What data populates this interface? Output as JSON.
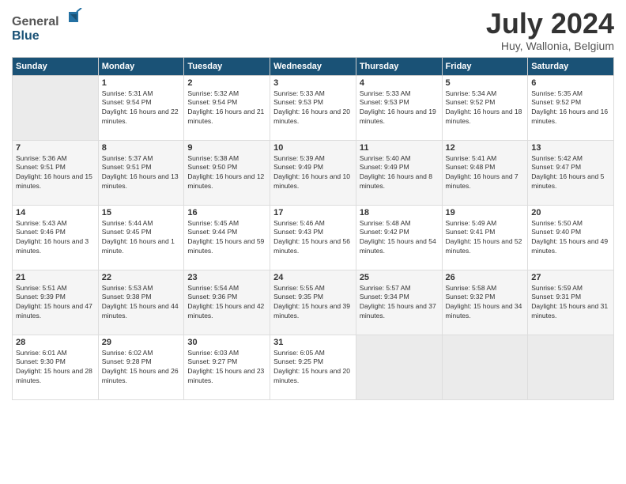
{
  "header": {
    "logo_general": "General",
    "logo_blue": "Blue",
    "month": "July 2024",
    "location": "Huy, Wallonia, Belgium"
  },
  "weekdays": [
    "Sunday",
    "Monday",
    "Tuesday",
    "Wednesday",
    "Thursday",
    "Friday",
    "Saturday"
  ],
  "weeks": [
    [
      {
        "day": "",
        "empty": true
      },
      {
        "day": "1",
        "sunrise": "Sunrise: 5:31 AM",
        "sunset": "Sunset: 9:54 PM",
        "daylight": "Daylight: 16 hours and 22 minutes."
      },
      {
        "day": "2",
        "sunrise": "Sunrise: 5:32 AM",
        "sunset": "Sunset: 9:54 PM",
        "daylight": "Daylight: 16 hours and 21 minutes."
      },
      {
        "day": "3",
        "sunrise": "Sunrise: 5:33 AM",
        "sunset": "Sunset: 9:53 PM",
        "daylight": "Daylight: 16 hours and 20 minutes."
      },
      {
        "day": "4",
        "sunrise": "Sunrise: 5:33 AM",
        "sunset": "Sunset: 9:53 PM",
        "daylight": "Daylight: 16 hours and 19 minutes."
      },
      {
        "day": "5",
        "sunrise": "Sunrise: 5:34 AM",
        "sunset": "Sunset: 9:52 PM",
        "daylight": "Daylight: 16 hours and 18 minutes."
      },
      {
        "day": "6",
        "sunrise": "Sunrise: 5:35 AM",
        "sunset": "Sunset: 9:52 PM",
        "daylight": "Daylight: 16 hours and 16 minutes."
      }
    ],
    [
      {
        "day": "7",
        "sunrise": "Sunrise: 5:36 AM",
        "sunset": "Sunset: 9:51 PM",
        "daylight": "Daylight: 16 hours and 15 minutes."
      },
      {
        "day": "8",
        "sunrise": "Sunrise: 5:37 AM",
        "sunset": "Sunset: 9:51 PM",
        "daylight": "Daylight: 16 hours and 13 minutes."
      },
      {
        "day": "9",
        "sunrise": "Sunrise: 5:38 AM",
        "sunset": "Sunset: 9:50 PM",
        "daylight": "Daylight: 16 hours and 12 minutes."
      },
      {
        "day": "10",
        "sunrise": "Sunrise: 5:39 AM",
        "sunset": "Sunset: 9:49 PM",
        "daylight": "Daylight: 16 hours and 10 minutes."
      },
      {
        "day": "11",
        "sunrise": "Sunrise: 5:40 AM",
        "sunset": "Sunset: 9:49 PM",
        "daylight": "Daylight: 16 hours and 8 minutes."
      },
      {
        "day": "12",
        "sunrise": "Sunrise: 5:41 AM",
        "sunset": "Sunset: 9:48 PM",
        "daylight": "Daylight: 16 hours and 7 minutes."
      },
      {
        "day": "13",
        "sunrise": "Sunrise: 5:42 AM",
        "sunset": "Sunset: 9:47 PM",
        "daylight": "Daylight: 16 hours and 5 minutes."
      }
    ],
    [
      {
        "day": "14",
        "sunrise": "Sunrise: 5:43 AM",
        "sunset": "Sunset: 9:46 PM",
        "daylight": "Daylight: 16 hours and 3 minutes."
      },
      {
        "day": "15",
        "sunrise": "Sunrise: 5:44 AM",
        "sunset": "Sunset: 9:45 PM",
        "daylight": "Daylight: 16 hours and 1 minute."
      },
      {
        "day": "16",
        "sunrise": "Sunrise: 5:45 AM",
        "sunset": "Sunset: 9:44 PM",
        "daylight": "Daylight: 15 hours and 59 minutes."
      },
      {
        "day": "17",
        "sunrise": "Sunrise: 5:46 AM",
        "sunset": "Sunset: 9:43 PM",
        "daylight": "Daylight: 15 hours and 56 minutes."
      },
      {
        "day": "18",
        "sunrise": "Sunrise: 5:48 AM",
        "sunset": "Sunset: 9:42 PM",
        "daylight": "Daylight: 15 hours and 54 minutes."
      },
      {
        "day": "19",
        "sunrise": "Sunrise: 5:49 AM",
        "sunset": "Sunset: 9:41 PM",
        "daylight": "Daylight: 15 hours and 52 minutes."
      },
      {
        "day": "20",
        "sunrise": "Sunrise: 5:50 AM",
        "sunset": "Sunset: 9:40 PM",
        "daylight": "Daylight: 15 hours and 49 minutes."
      }
    ],
    [
      {
        "day": "21",
        "sunrise": "Sunrise: 5:51 AM",
        "sunset": "Sunset: 9:39 PM",
        "daylight": "Daylight: 15 hours and 47 minutes."
      },
      {
        "day": "22",
        "sunrise": "Sunrise: 5:53 AM",
        "sunset": "Sunset: 9:38 PM",
        "daylight": "Daylight: 15 hours and 44 minutes."
      },
      {
        "day": "23",
        "sunrise": "Sunrise: 5:54 AM",
        "sunset": "Sunset: 9:36 PM",
        "daylight": "Daylight: 15 hours and 42 minutes."
      },
      {
        "day": "24",
        "sunrise": "Sunrise: 5:55 AM",
        "sunset": "Sunset: 9:35 PM",
        "daylight": "Daylight: 15 hours and 39 minutes."
      },
      {
        "day": "25",
        "sunrise": "Sunrise: 5:57 AM",
        "sunset": "Sunset: 9:34 PM",
        "daylight": "Daylight: 15 hours and 37 minutes."
      },
      {
        "day": "26",
        "sunrise": "Sunrise: 5:58 AM",
        "sunset": "Sunset: 9:32 PM",
        "daylight": "Daylight: 15 hours and 34 minutes."
      },
      {
        "day": "27",
        "sunrise": "Sunrise: 5:59 AM",
        "sunset": "Sunset: 9:31 PM",
        "daylight": "Daylight: 15 hours and 31 minutes."
      }
    ],
    [
      {
        "day": "28",
        "sunrise": "Sunrise: 6:01 AM",
        "sunset": "Sunset: 9:30 PM",
        "daylight": "Daylight: 15 hours and 28 minutes."
      },
      {
        "day": "29",
        "sunrise": "Sunrise: 6:02 AM",
        "sunset": "Sunset: 9:28 PM",
        "daylight": "Daylight: 15 hours and 26 minutes."
      },
      {
        "day": "30",
        "sunrise": "Sunrise: 6:03 AM",
        "sunset": "Sunset: 9:27 PM",
        "daylight": "Daylight: 15 hours and 23 minutes."
      },
      {
        "day": "31",
        "sunrise": "Sunrise: 6:05 AM",
        "sunset": "Sunset: 9:25 PM",
        "daylight": "Daylight: 15 hours and 20 minutes."
      },
      {
        "day": "",
        "empty": true
      },
      {
        "day": "",
        "empty": true
      },
      {
        "day": "",
        "empty": true
      }
    ]
  ]
}
